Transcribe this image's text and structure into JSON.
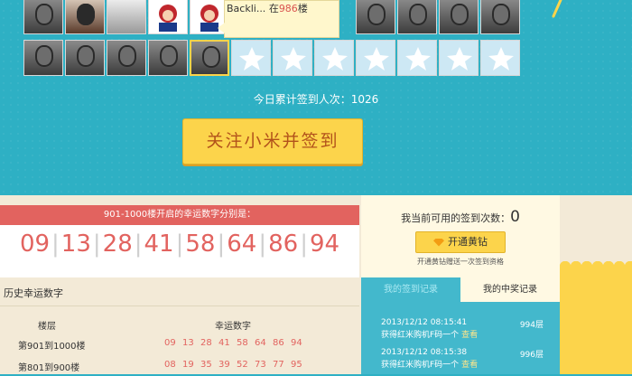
{
  "tooltip": {
    "name": "Backli...",
    "prefix": "在",
    "floor": "986",
    "suffix": "楼"
  },
  "stats": {
    "label": "今日累计签到人次：",
    "count": "1026"
  },
  "follow_button": "关注小米并签到",
  "lucky": {
    "header": "901-1000楼开启的幸运数字分别是：",
    "numbers": [
      "09",
      "13",
      "28",
      "41",
      "58",
      "64",
      "86",
      "94"
    ]
  },
  "history": {
    "title": "历史幸运数字",
    "col_floor": "楼层",
    "col_numbers": "幸运数字",
    "rows": [
      {
        "floor": "第901到1000楼",
        "numbers": [
          "09",
          "13",
          "28",
          "41",
          "58",
          "64",
          "86",
          "94"
        ]
      },
      {
        "floor": "第801到900楼",
        "numbers": [
          "08",
          "19",
          "35",
          "39",
          "52",
          "73",
          "77",
          "95"
        ]
      }
    ]
  },
  "sidebar": {
    "available_label": "我当前可用的签到次数：",
    "available_count": "0",
    "open_button": "开通黄钻",
    "open_note": "开通黄钻赠送一次签到资格",
    "tabs": [
      "我的签到记录",
      "我的中奖记录"
    ],
    "records": [
      {
        "time": "2013/12/12 08:15:41",
        "floor": "994层",
        "desc": "获得红米购机F码一个",
        "view": "查看"
      },
      {
        "time": "2013/12/12 08:15:38",
        "floor": "996层",
        "desc": "获得红米购机F码一个",
        "view": "查看"
      }
    ]
  },
  "colors": {
    "teal": "#2eb0c4",
    "red": "#e2635f",
    "yellow": "#fcd44b",
    "cream": "#f3ead7"
  },
  "icons": {
    "star": "star-icon",
    "diamond": "yellow-diamond-icon"
  }
}
